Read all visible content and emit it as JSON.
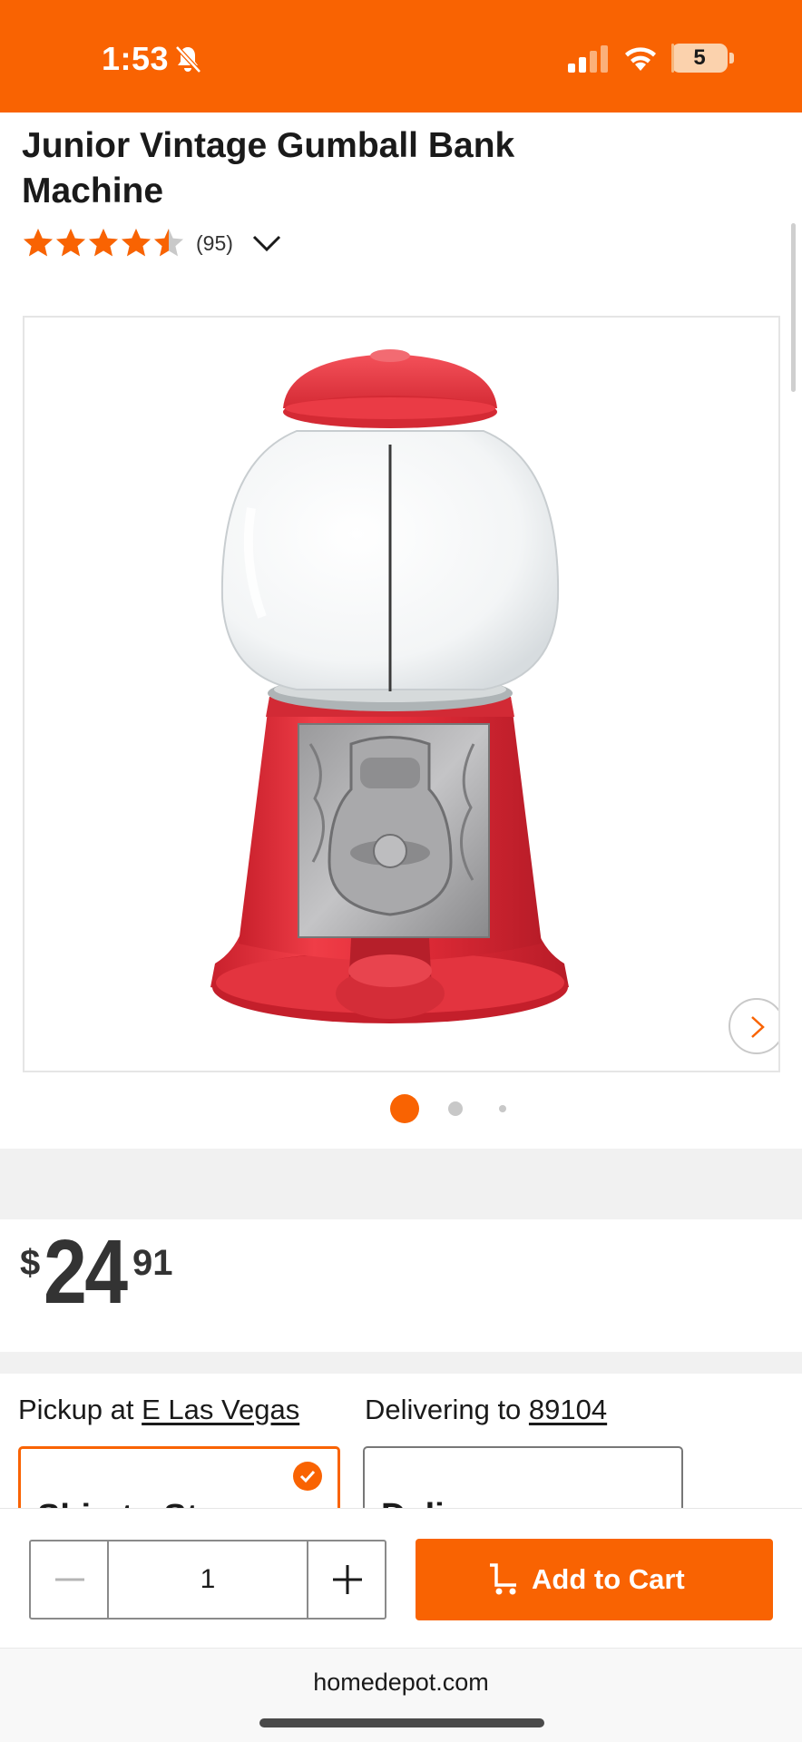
{
  "status_bar": {
    "time": "1:53",
    "battery_level": "5",
    "battery_fraction": 0.05,
    "icons": [
      "bell-slash-icon",
      "cellular-signal-icon",
      "wifi-icon",
      "battery-icon"
    ],
    "background": "#f96302"
  },
  "product": {
    "title": "Junior Vintage Gumball Bank Machine",
    "rating": 4.5,
    "rating_max": 5,
    "review_count": "(95)",
    "price_currency": "$",
    "price_dollars": "24",
    "price_cents": "91",
    "image_count": 3,
    "current_image": 1
  },
  "fulfillment": {
    "pickup_prefix": "Pickup at ",
    "pickup_store": "E Las Vegas",
    "delivery_prefix": "Delivering to ",
    "delivery_zip": "89104",
    "pickup_option_title": "Ship to Store",
    "delivery_option_title": "Delivery"
  },
  "cart": {
    "quantity": "1",
    "add_label": "Add to Cart"
  },
  "browser": {
    "url": "homedepot.com"
  },
  "colors": {
    "accent": "#f96302",
    "star": "#f96302",
    "star_empty": "#c9c9c9",
    "dot_active": "#f96302",
    "dot_inactive": "#c8c8c8"
  }
}
